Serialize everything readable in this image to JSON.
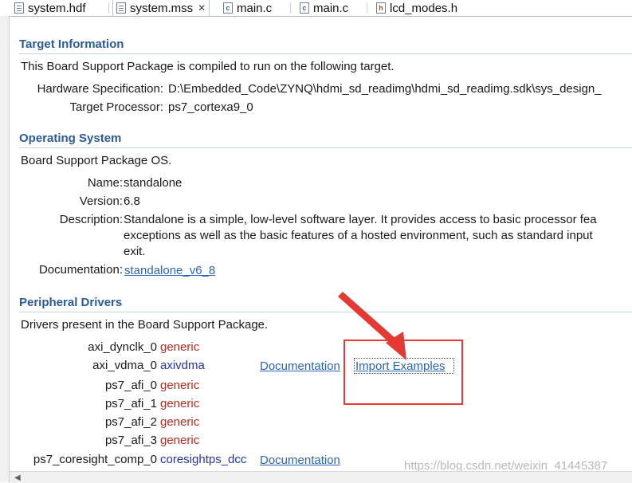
{
  "tabs": [
    {
      "label": "system.hdf",
      "icon": "file-icon",
      "active": false
    },
    {
      "label": "system.mss",
      "icon": "mss-file-icon",
      "active": true,
      "close": "✕"
    },
    {
      "label": "main.c",
      "icon": "c-file-icon",
      "active": false
    },
    {
      "label": "main.c",
      "icon": "c-file-icon",
      "active": false
    },
    {
      "label": "lcd_modes.h",
      "icon": "h-file-icon",
      "active": false
    }
  ],
  "target": {
    "title": "Target Information",
    "intro": "This Board Support Package is compiled to run on the following target.",
    "hw_label": "Hardware Specification:",
    "hw_value": "D:\\Embedded_Code\\ZYNQ\\hdmi_sd_readimg\\hdmi_sd_readimg.sdk\\sys_design_",
    "proc_label": "Target Processor:",
    "proc_value": "ps7_cortexa9_0"
  },
  "os": {
    "title": "Operating System",
    "intro": "Board Support Package OS.",
    "name_label": "Name:",
    "name_value": "standalone",
    "version_label": "Version:",
    "version_value": "6.8",
    "desc_label": "Description:",
    "desc_line1": "Standalone is a simple, low-level software layer. It provides access to basic processor fea",
    "desc_line2": "exceptions as well as the basic features of a hosted environment, such as standard input",
    "desc_line3": "exit.",
    "doc_label": "Documentation:",
    "doc_link": "standalone_v6_8"
  },
  "drivers": {
    "title": "Peripheral Drivers",
    "intro": "Drivers present in the Board Support Package.",
    "items": [
      {
        "name": "axi_dynclk_0",
        "driver": "generic"
      },
      {
        "name": "axi_vdma_0",
        "driver": "axivdma",
        "doc": "Documentation",
        "examples": "Import Examples"
      },
      {
        "name": "ps7_afi_0",
        "driver": "generic"
      },
      {
        "name": "ps7_afi_1",
        "driver": "generic"
      },
      {
        "name": "ps7_afi_2",
        "driver": "generic"
      },
      {
        "name": "ps7_afi_3",
        "driver": "generic"
      },
      {
        "name": "ps7_coresight_comp_0",
        "driver": "coresightps_dcc",
        "doc": "Documentation"
      }
    ]
  },
  "watermark": "https://blog.csdn.net/weixin_41445387",
  "colors": {
    "section_title": "#2c5a9e",
    "link": "#2b64b8",
    "generic": "#c0281b",
    "annotation": "#e53935"
  }
}
